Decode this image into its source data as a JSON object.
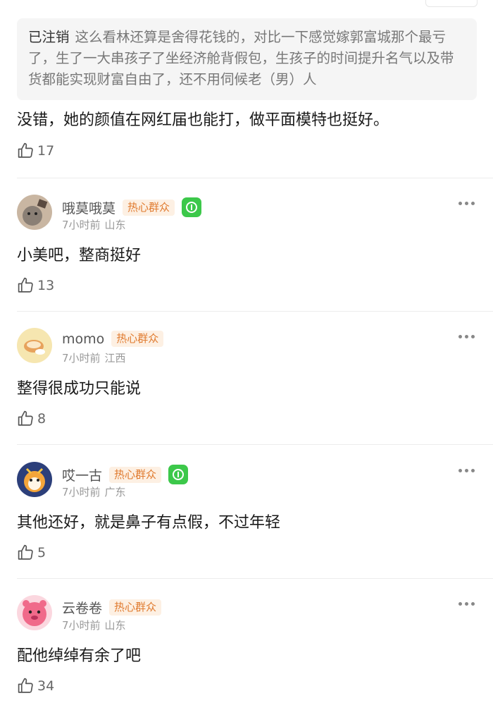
{
  "quote": {
    "name": "已注销",
    "text": "这么看林还算是舍得花钱的，对比一下感觉嫁郭富城那个最亏了，生了一大串孩子了坐经济舱背假包，生孩子的时间提升名气以及带货都能实现财富自由了，还不用伺候老（男）人"
  },
  "reply": {
    "text": "没错，她的颜值在网红届也能打，做平面模特也挺好。",
    "likes": "17"
  },
  "comments": [
    {
      "name": "哦莫哦莫",
      "badge": "热心群众",
      "has_level_icon": true,
      "time": "7小时前",
      "location": "山东",
      "text": "小美吧，整商挺好",
      "likes": "13",
      "avatar_color": "#8a7f75"
    },
    {
      "name": "momo",
      "badge": "热心群众",
      "has_level_icon": false,
      "time": "7小时前",
      "location": "江西",
      "text": "整得很成功只能说",
      "likes": "8",
      "avatar_color": "#f6e6b0"
    },
    {
      "name": "哎一古",
      "badge": "热心群众",
      "has_level_icon": true,
      "time": "7小时前",
      "location": "广东",
      "text": "其他还好，就是鼻子有点假，不过年轻",
      "likes": "5",
      "avatar_color": "#2c3f7a"
    },
    {
      "name": "云卷卷",
      "badge": "热心群众",
      "has_level_icon": false,
      "time": "7小时前",
      "location": "山东",
      "text": "配他绰绰有余了吧",
      "likes": "34",
      "avatar_color": "#f06a8a"
    }
  ],
  "icons": {
    "like": "thumbs-up-icon",
    "more": "more-dots-icon",
    "level": "level-badge-icon"
  },
  "colors": {
    "badge_text": "#e07a2e",
    "badge_bg": "#fdf0e3",
    "level_green": "#3cc84a"
  }
}
